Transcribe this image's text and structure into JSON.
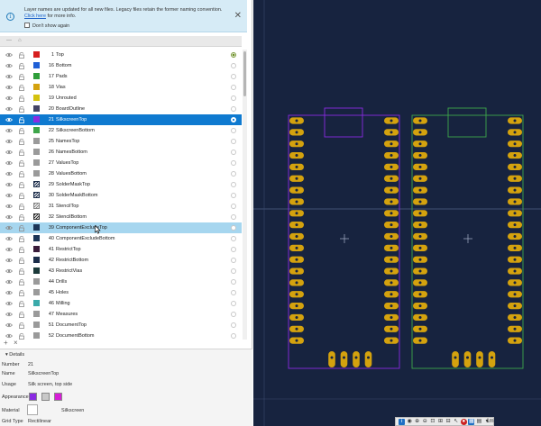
{
  "banner": {
    "message": "Layer names are updated for all new files. Legacy files retain the former naming convention.",
    "link": "Click here",
    "message_tail": "for more info.",
    "dont_show": "Don't show again"
  },
  "layers": [
    {
      "num": "1",
      "name": "Top",
      "color": "#d61e1e",
      "active": true
    },
    {
      "num": "16",
      "name": "Bottom",
      "color": "#1f5fd6"
    },
    {
      "num": "17",
      "name": "Pads",
      "color": "#2f9e3a"
    },
    {
      "num": "18",
      "name": "Vias",
      "color": "#d4a20e"
    },
    {
      "num": "19",
      "name": "Unrouted",
      "color": "#d4c20e"
    },
    {
      "num": "20",
      "name": "BoardOutline",
      "color": "#444466"
    },
    {
      "num": "21",
      "name": "SilkscreenTop",
      "color": "#8a2be2",
      "selected": true
    },
    {
      "num": "22",
      "name": "SilkscreenBottom",
      "color": "#3ea64a"
    },
    {
      "num": "25",
      "name": "NamesTop",
      "color": "#9a9a9a"
    },
    {
      "num": "26",
      "name": "NamesBottom",
      "color": "#9a9a9a"
    },
    {
      "num": "27",
      "name": "ValuesTop",
      "color": "#9a9a9a"
    },
    {
      "num": "28",
      "name": "ValuesBottom",
      "color": "#9a9a9a"
    },
    {
      "num": "29",
      "name": "SolderMaskTop",
      "color": "#1c2d4a",
      "pattern": "hatch"
    },
    {
      "num": "30",
      "name": "SolderMaskBottom",
      "color": "#1c2d4a",
      "pattern": "hatch"
    },
    {
      "num": "31",
      "name": "StencilTop",
      "color": "#8a8a8a",
      "pattern": "hatch"
    },
    {
      "num": "32",
      "name": "StencilBottom",
      "color": "#333333",
      "pattern": "hatch"
    },
    {
      "num": "39",
      "name": "ComponentExcludeTop",
      "color": "#1c3557",
      "hover": true
    },
    {
      "num": "40",
      "name": "ComponentExcludeBottom",
      "color": "#1c3557"
    },
    {
      "num": "41",
      "name": "RestrictTop",
      "color": "#3a1c3a"
    },
    {
      "num": "42",
      "name": "RestrictBottom",
      "color": "#1c2d4a"
    },
    {
      "num": "43",
      "name": "RestrictVias",
      "color": "#1c3a3a"
    },
    {
      "num": "44",
      "name": "Drills",
      "color": "#9a9a9a"
    },
    {
      "num": "45",
      "name": "Holes",
      "color": "#9a9a9a"
    },
    {
      "num": "46",
      "name": "Milling",
      "color": "#3aaaaa"
    },
    {
      "num": "47",
      "name": "Measures",
      "color": "#9a9a9a"
    },
    {
      "num": "51",
      "name": "DocumentTop",
      "color": "#9a9a9a"
    },
    {
      "num": "52",
      "name": "DocumentBottom",
      "color": "#9a9a9a"
    }
  ],
  "details": {
    "header": "Details",
    "number_label": "Number",
    "number_value": "21",
    "name_label": "Name",
    "name_value": "SilkscreenTop",
    "usage_label": "Usage",
    "usage_value": "Silk screen, top side",
    "appearance_label": "Appearance",
    "appearance_colors": [
      "#8a2be2",
      "#c8c8c8",
      "#d61ed6"
    ],
    "material_label": "Material",
    "material_value": "Silkscreen",
    "grid_type_label": "Grid Type",
    "grid_type_value": "Rectilinear"
  },
  "toolbar": {
    "items": [
      "info-icon",
      "eye-icon",
      "zoom-in-icon",
      "zoom-out-icon",
      "zoom-fit-icon",
      "zoom-select-icon",
      "zoom-prev-icon",
      "pointer-icon",
      "stop-icon",
      "grid-icon",
      "layers-icon",
      "zoom-level-icon"
    ],
    "zoom_label": "1m"
  },
  "colors": {
    "canvas_bg": "#17233f",
    "pad": "#d4a20e",
    "silk_top": "#8a2be2",
    "silk_bottom": "#3ea64a",
    "selection": "#0f7ad0",
    "hover": "#a6d6ef"
  }
}
